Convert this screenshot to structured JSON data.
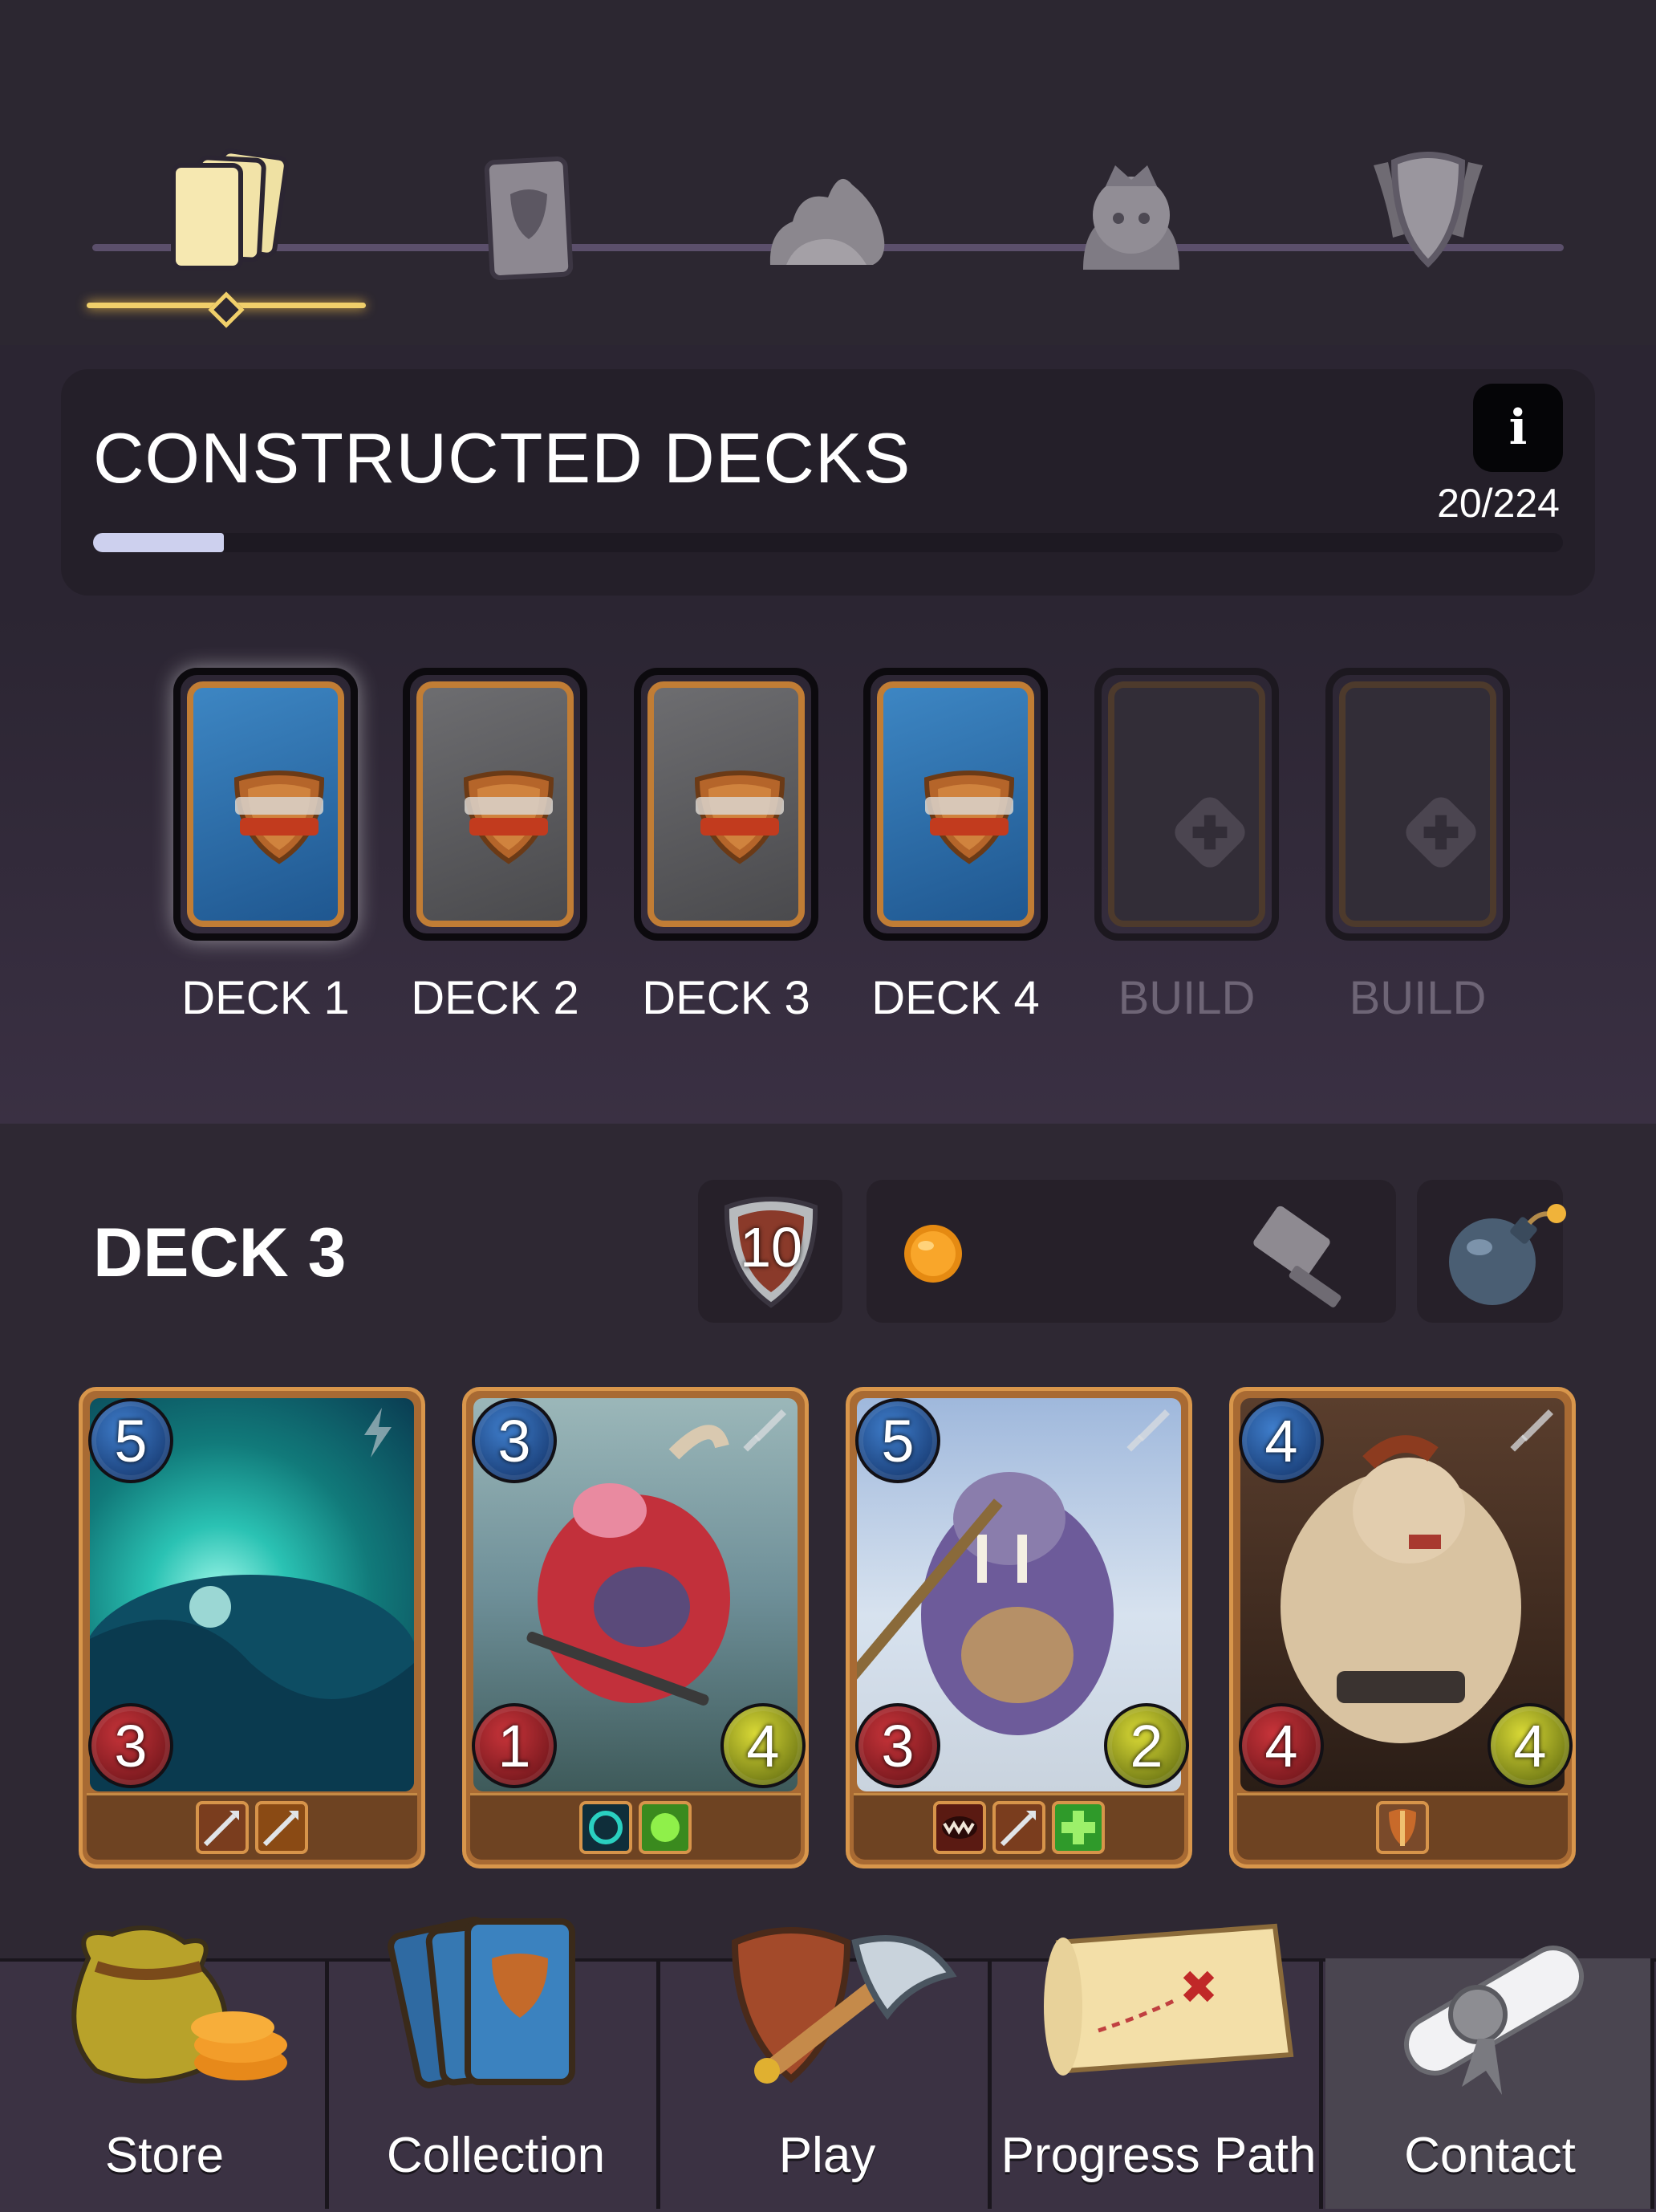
{
  "top_nav": {
    "items": [
      {
        "id": "decks",
        "icon": "cards-stack-icon",
        "active": true
      },
      {
        "id": "card",
        "icon": "card-back-icon",
        "active": false
      },
      {
        "id": "terrain",
        "icon": "rock-icon",
        "active": false
      },
      {
        "id": "heroes",
        "icon": "queen-icon",
        "active": false
      },
      {
        "id": "league",
        "icon": "shield-crest-icon",
        "active": false
      }
    ]
  },
  "progress": {
    "title": "CONSTRUCTED DECKS",
    "info_label": "i",
    "count": "20/224",
    "fraction": 0.089
  },
  "decks": [
    {
      "label": "DECK 1",
      "style": "blue",
      "selected": true
    },
    {
      "label": "DECK 2",
      "style": "gray",
      "selected": false
    },
    {
      "label": "DECK 3",
      "style": "gray",
      "selected": false
    },
    {
      "label": "DECK 4",
      "style": "blue",
      "selected": false
    },
    {
      "label": "BUILD",
      "style": "empty",
      "selected": false
    },
    {
      "label": "BUILD",
      "style": "empty",
      "selected": false
    }
  ],
  "selected_deck": {
    "title": "DECK 3",
    "level": "10",
    "cards": [
      {
        "mana": "5",
        "attack": "3",
        "health": "",
        "type_icon": "lightning-icon",
        "art": "cave-crystal",
        "abilities": [
          "arrow-ability-icon",
          "dash-ability-icon"
        ]
      },
      {
        "mana": "3",
        "attack": "1",
        "health": "4",
        "type_icon": "sword-icon",
        "art": "red-pig-miner",
        "abilities": [
          "vortex-ability-icon",
          "green-heal-ability-icon"
        ]
      },
      {
        "mana": "5",
        "attack": "3",
        "health": "2",
        "type_icon": "sword-icon",
        "art": "walrus-warrior",
        "abilities": [
          "bite-ability-icon",
          "arrow-ability-icon",
          "plus-ability-icon"
        ]
      },
      {
        "mana": "4",
        "attack": "4",
        "health": "4",
        "type_icon": "sword-icon",
        "art": "orc-brute",
        "abilities": [
          "shield-break-ability-icon"
        ]
      }
    ]
  },
  "bottom_nav": {
    "items": [
      {
        "label": "Store",
        "icon": "coin-bag-icon"
      },
      {
        "label": "Collection",
        "icon": "card-fan-icon"
      },
      {
        "label": "Play",
        "icon": "shield-axe-icon"
      },
      {
        "label": "Progress Path",
        "icon": "treasure-map-icon"
      },
      {
        "label": "Contact",
        "icon": "scroll-icon",
        "active": true
      }
    ]
  },
  "colors": {
    "accent_gold": "#f0cf6a",
    "card_frame": "#c17d35",
    "progress_fill": "#cdd0ee"
  }
}
